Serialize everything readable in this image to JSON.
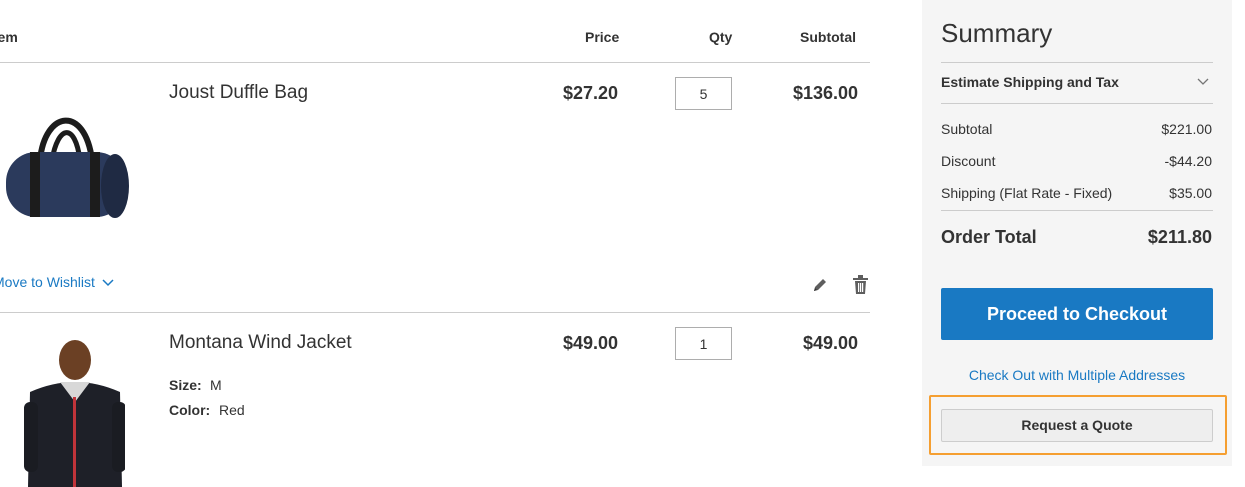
{
  "cart": {
    "headers": {
      "item": "Item",
      "price": "Price",
      "qty": "Qty",
      "subtotal": "Subtotal"
    },
    "items": [
      {
        "name": "Joust Duffle Bag",
        "price": "$27.20",
        "qty": "5",
        "subtotal": "$136.00",
        "image_icon": "duffle-bag-image"
      },
      {
        "name": "Montana Wind Jacket",
        "price": "$49.00",
        "qty": "1",
        "subtotal": "$49.00",
        "image_icon": "jacket-image",
        "options": [
          {
            "label": "Size:",
            "value": "M"
          },
          {
            "label": "Color:",
            "value": "Red"
          }
        ]
      }
    ],
    "move_to_wishlist": "Move to Wishlist",
    "edit_icon": "pencil-icon",
    "delete_icon": "trash-icon"
  },
  "summary": {
    "title": "Summary",
    "estimate_label": "Estimate Shipping and Tax",
    "rows": [
      {
        "label": "Subtotal",
        "value": "$221.00"
      },
      {
        "label": "Discount",
        "value": "-$44.20"
      },
      {
        "label": "Shipping (Flat Rate - Fixed)",
        "value": "$35.00"
      }
    ],
    "order_total_label": "Order Total",
    "order_total_value": "$211.80",
    "checkout_label": "Proceed to Checkout",
    "multi_address_label": "Check Out with Multiple Addresses",
    "quote_label": "Request a Quote"
  },
  "colors": {
    "accent": "#1979c3",
    "highlight": "#f59f31",
    "summary_bg": "#f5f5f5"
  }
}
